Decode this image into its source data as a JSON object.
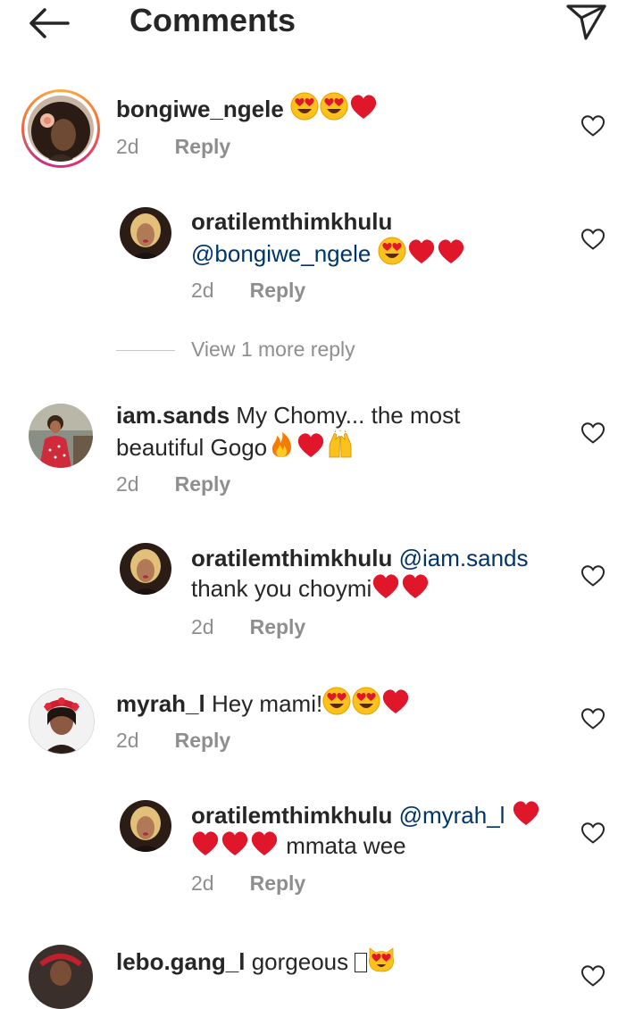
{
  "header": {
    "title": "Comments"
  },
  "comments": [
    {
      "username": "bongiwe_ngele",
      "mention": "",
      "text": "",
      "emojis": "😍😍❤️",
      "time": "2d",
      "reply": "Reply"
    },
    {
      "username": "oratilemthimkhulu",
      "mention": "@bongiwe_ngele",
      "text": "",
      "emojis": "😍❤️❤️",
      "time": "2d",
      "reply": "Reply"
    },
    {
      "username": "iam.sands",
      "mention": "",
      "text": "My Chomy... the most beautiful Gogo",
      "emojis": "🔥❤️🙌",
      "time": "2d",
      "reply": "Reply"
    },
    {
      "username": "oratilemthimkhulu",
      "mention": "@iam.sands",
      "text": "thank you choymi",
      "emojis": "❤️❤️",
      "time": "2d",
      "reply": "Reply"
    },
    {
      "username": "myrah_l",
      "mention": "",
      "text": "Hey mami!",
      "emojis": "😍😍❤️",
      "time": "2d",
      "reply": "Reply"
    },
    {
      "username": "oratilemthimkhulu",
      "mention": "@myrah_l",
      "text": "mmata wee",
      "emojis": "❤️❤️❤️❤️",
      "time": "2d",
      "reply": "Reply"
    },
    {
      "username": "lebo.gang_l",
      "mention": "",
      "text": "gorgeous",
      "emojis": "😻",
      "time": "",
      "reply": ""
    }
  ],
  "view_more": "View 1 more reply",
  "icons": {
    "back": "back-arrow-icon",
    "send": "send-icon",
    "like": "heart-outline-icon"
  },
  "colors": {
    "text": "#262626",
    "secondary": "#8e8e8e",
    "mention": "#003569",
    "heart": "#e0162b"
  }
}
